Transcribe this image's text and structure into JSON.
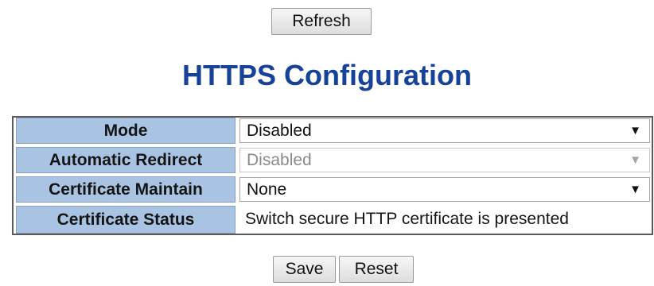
{
  "toolbar": {
    "refresh_label": "Refresh"
  },
  "page": {
    "title": "HTTPS Configuration"
  },
  "config": {
    "mode": {
      "label": "Mode",
      "value": "Disabled",
      "enabled": true
    },
    "automatic_redirect": {
      "label": "Automatic Redirect",
      "value": "Disabled",
      "enabled": false
    },
    "certificate_maintain": {
      "label": "Certificate Maintain",
      "value": "None",
      "enabled": true
    },
    "certificate_status": {
      "label": "Certificate Status",
      "value": "Switch secure HTTP certificate is presented"
    }
  },
  "actions": {
    "save_label": "Save",
    "reset_label": "Reset"
  },
  "icons": {
    "dropdown": "chevron-down-icon"
  },
  "colors": {
    "title": "#17429a",
    "label_background": "#a9c4e3",
    "table_border": "#5a5a5a"
  }
}
